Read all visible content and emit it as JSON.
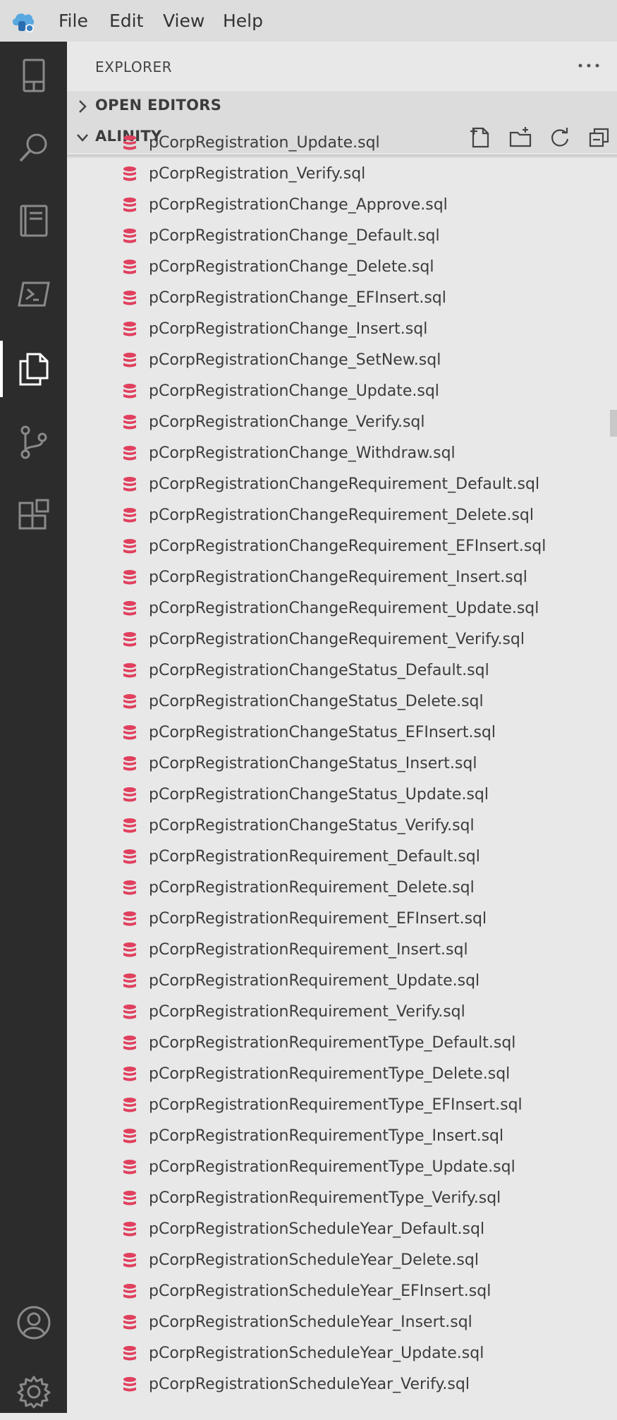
{
  "menu": [
    "File",
    "Edit",
    "View",
    "Help"
  ],
  "explorer": {
    "title": "EXPLORER",
    "sections": {
      "open_editors": "OPEN EDITORS",
      "project": "ALINITY"
    }
  },
  "files": [
    "pCorpRegistration_Update.sql",
    "pCorpRegistration_Verify.sql",
    "pCorpRegistrationChange_Approve.sql",
    "pCorpRegistrationChange_Default.sql",
    "pCorpRegistrationChange_Delete.sql",
    "pCorpRegistrationChange_EFInsert.sql",
    "pCorpRegistrationChange_Insert.sql",
    "pCorpRegistrationChange_SetNew.sql",
    "pCorpRegistrationChange_Update.sql",
    "pCorpRegistrationChange_Verify.sql",
    "pCorpRegistrationChange_Withdraw.sql",
    "pCorpRegistrationChangeRequirement_Default.sql",
    "pCorpRegistrationChangeRequirement_Delete.sql",
    "pCorpRegistrationChangeRequirement_EFInsert.sql",
    "pCorpRegistrationChangeRequirement_Insert.sql",
    "pCorpRegistrationChangeRequirement_Update.sql",
    "pCorpRegistrationChangeRequirement_Verify.sql",
    "pCorpRegistrationChangeStatus_Default.sql",
    "pCorpRegistrationChangeStatus_Delete.sql",
    "pCorpRegistrationChangeStatus_EFInsert.sql",
    "pCorpRegistrationChangeStatus_Insert.sql",
    "pCorpRegistrationChangeStatus_Update.sql",
    "pCorpRegistrationChangeStatus_Verify.sql",
    "pCorpRegistrationRequirement_Default.sql",
    "pCorpRegistrationRequirement_Delete.sql",
    "pCorpRegistrationRequirement_EFInsert.sql",
    "pCorpRegistrationRequirement_Insert.sql",
    "pCorpRegistrationRequirement_Update.sql",
    "pCorpRegistrationRequirement_Verify.sql",
    "pCorpRegistrationRequirementType_Default.sql",
    "pCorpRegistrationRequirementType_Delete.sql",
    "pCorpRegistrationRequirementType_EFInsert.sql",
    "pCorpRegistrationRequirementType_Insert.sql",
    "pCorpRegistrationRequirementType_Update.sql",
    "pCorpRegistrationRequirementType_Verify.sql",
    "pCorpRegistrationScheduleYear_Default.sql",
    "pCorpRegistrationScheduleYear_Delete.sql",
    "pCorpRegistrationScheduleYear_EFInsert.sql",
    "pCorpRegistrationScheduleYear_Insert.sql",
    "pCorpRegistrationScheduleYear_Update.sql",
    "pCorpRegistrationScheduleYear_Verify.sql"
  ],
  "icons": {
    "file": "database-icon",
    "activity": [
      "connections-icon",
      "search-icon",
      "notebooks-icon",
      "terminal-icon",
      "explorer-icon",
      "source-control-icon",
      "extensions-icon",
      "account-icon",
      "settings-gear-icon"
    ]
  },
  "colors": {
    "accent_db": "#e0405e",
    "activity_bg": "#2c2c2c",
    "sidebar_bg": "#e8e8e8"
  }
}
